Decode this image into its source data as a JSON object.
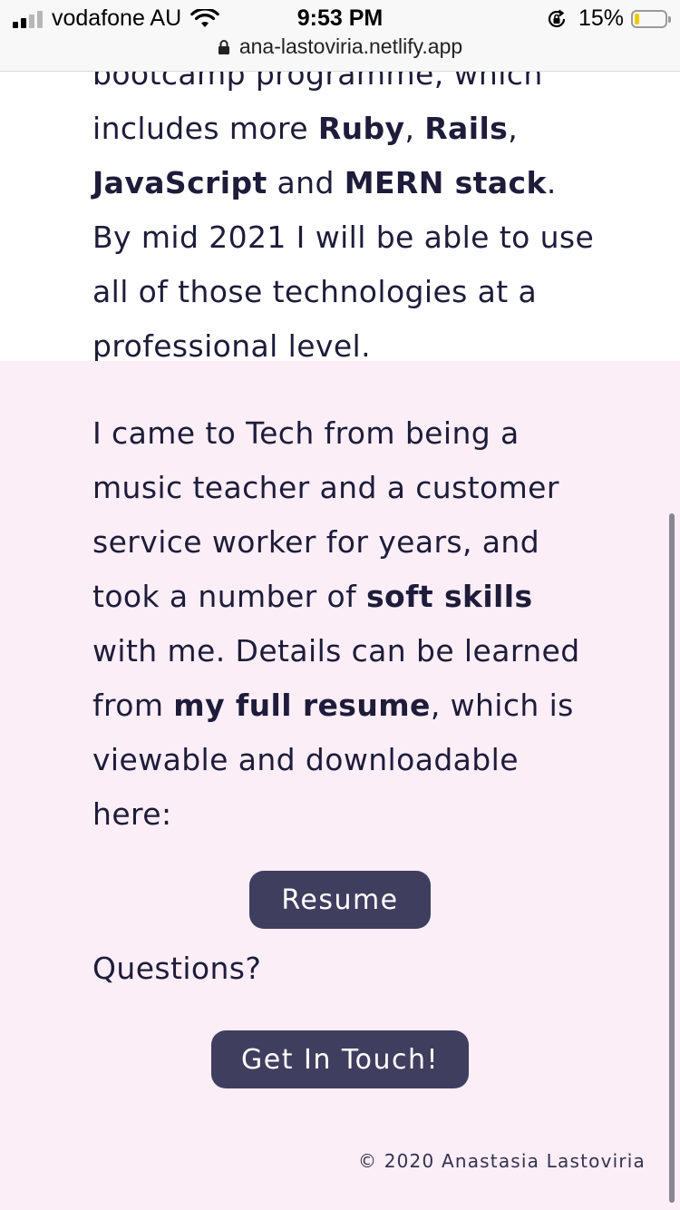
{
  "status_bar": {
    "carrier": "vodafone AU",
    "time": "9:53 PM",
    "battery": "15%",
    "battery_level": 0.15,
    "signal_bars_active": 2,
    "icons": [
      "signal-icon",
      "wifi-icon",
      "rotation-lock-icon",
      "battery-icon"
    ]
  },
  "url_bar": {
    "domain": "ana-lastoviria.netlify.app",
    "icon": "padlock-icon"
  },
  "content": {
    "top_paragraph": [
      {
        "text": "bootcamp programme, which includes more ",
        "bold": false
      },
      {
        "text": "Ruby",
        "bold": true
      },
      {
        "text": ", ",
        "bold": false
      },
      {
        "text": "Rails",
        "bold": true
      },
      {
        "text": ", ",
        "bold": false
      },
      {
        "text": "JavaScript",
        "bold": true
      },
      {
        "text": " and ",
        "bold": false
      },
      {
        "text": "MERN stack",
        "bold": true
      },
      {
        "text": ". By mid 2021 I will be able to use all of those technologies at a professional level.",
        "bold": false
      }
    ],
    "pink_paragraph": [
      {
        "text": "I came to Tech from being a music teacher and a customer service worker for years, and took a number of ",
        "bold": false
      },
      {
        "text": "soft skills",
        "bold": true
      },
      {
        "text": " with me. Details can be learned from ",
        "bold": false
      },
      {
        "text": "my full resume",
        "bold": true
      },
      {
        "text": ", which is viewable and downloadable here:",
        "bold": false
      }
    ],
    "resume_button": "Resume",
    "questions": "Questions?",
    "contact_button": "Get In Touch!",
    "copyright": "© 2020 Anastasia Lastoviria"
  },
  "colors": {
    "text": "#1e1c3a",
    "button": "#403e5f",
    "pink_background": "#fbeef7"
  }
}
